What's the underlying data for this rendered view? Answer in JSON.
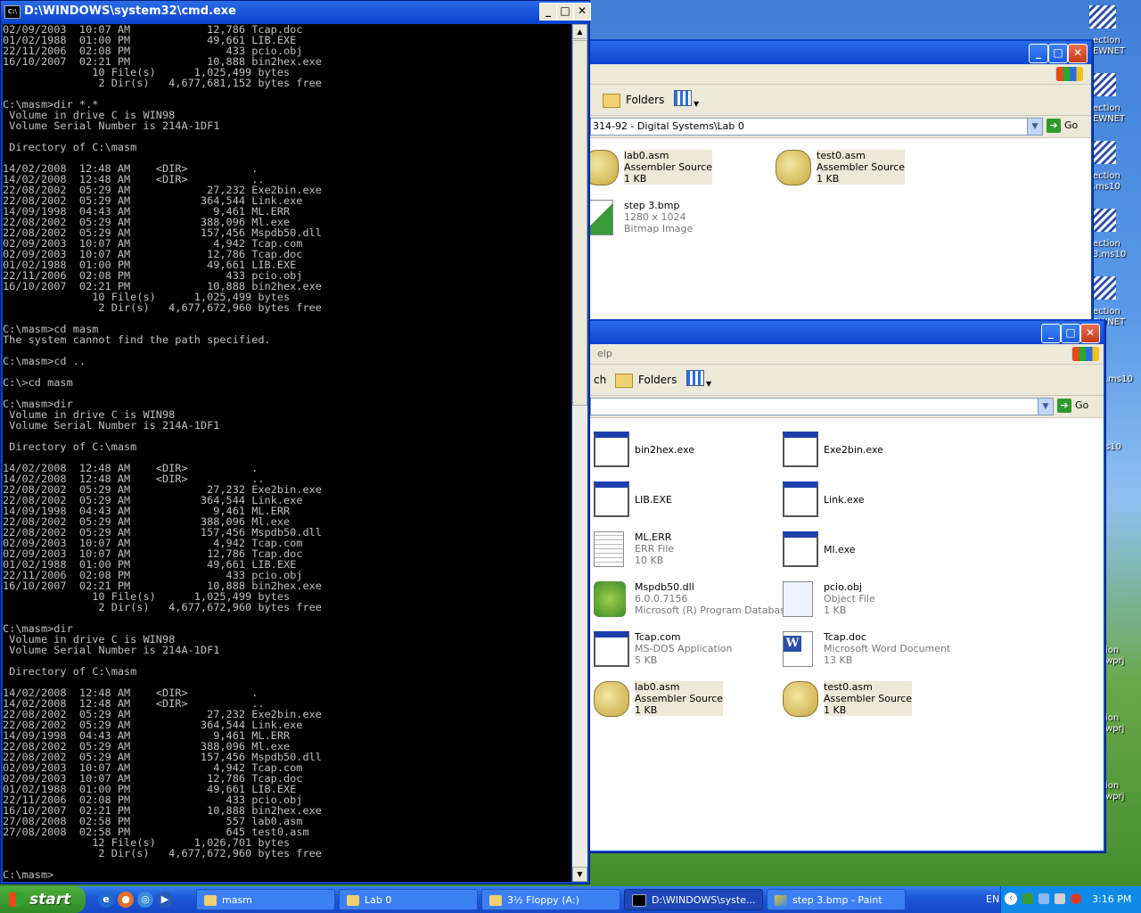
{
  "cmd": {
    "title": "D:\\WINDOWS\\system32\\cmd.exe",
    "icon_text": "C:\\",
    "lines": [
      "02/09/2003  10:07 AM            12,786 Tcap.doc",
      "01/02/1988  01:00 PM            49,661 LIB.EXE",
      "22/11/2006  02:08 PM               433 pcio.obj",
      "16/10/2007  02:21 PM            10,888 bin2hex.exe",
      "              10 File(s)      1,025,499 bytes",
      "               2 Dir(s)   4,677,681,152 bytes free",
      "",
      "C:\\masm>dir *.*",
      " Volume in drive C is WIN98",
      " Volume Serial Number is 214A-1DF1",
      "",
      " Directory of C:\\masm",
      "",
      "14/02/2008  12:48 AM    <DIR>          .",
      "14/02/2008  12:48 AM    <DIR>          ..",
      "22/08/2002  05:29 AM            27,232 Exe2bin.exe",
      "22/08/2002  05:29 AM           364,544 Link.exe",
      "14/09/1998  04:43 AM             9,461 ML.ERR",
      "22/08/2002  05:29 AM           388,096 Ml.exe",
      "22/08/2002  05:29 AM           157,456 Mspdb50.dll",
      "02/09/2003  10:07 AM             4,942 Tcap.com",
      "02/09/2003  10:07 AM            12,786 Tcap.doc",
      "01/02/1988  01:00 PM            49,661 LIB.EXE",
      "22/11/2006  02:08 PM               433 pcio.obj",
      "16/10/2007  02:21 PM            10,888 bin2hex.exe",
      "              10 File(s)      1,025,499 bytes",
      "               2 Dir(s)   4,677,672,960 bytes free",
      "",
      "C:\\masm>cd masm",
      "The system cannot find the path specified.",
      "",
      "C:\\masm>cd ..",
      "",
      "C:\\>cd masm",
      "",
      "C:\\masm>dir",
      " Volume in drive C is WIN98",
      " Volume Serial Number is 214A-1DF1",
      "",
      " Directory of C:\\masm",
      "",
      "14/02/2008  12:48 AM    <DIR>          .",
      "14/02/2008  12:48 AM    <DIR>          ..",
      "22/08/2002  05:29 AM            27,232 Exe2bin.exe",
      "22/08/2002  05:29 AM           364,544 Link.exe",
      "14/09/1998  04:43 AM             9,461 ML.ERR",
      "22/08/2002  05:29 AM           388,096 Ml.exe",
      "22/08/2002  05:29 AM           157,456 Mspdb50.dll",
      "02/09/2003  10:07 AM             4,942 Tcap.com",
      "02/09/2003  10:07 AM            12,786 Tcap.doc",
      "01/02/1988  01:00 PM            49,661 LIB.EXE",
      "22/11/2006  02:08 PM               433 pcio.obj",
      "16/10/2007  02:21 PM            10,888 bin2hex.exe",
      "              10 File(s)      1,025,499 bytes",
      "               2 Dir(s)   4,677,672,960 bytes free",
      "",
      "C:\\masm>dir",
      " Volume in drive C is WIN98",
      " Volume Serial Number is 214A-1DF1",
      "",
      " Directory of C:\\masm",
      "",
      "14/02/2008  12:48 AM    <DIR>          .",
      "14/02/2008  12:48 AM    <DIR>          ..",
      "22/08/2002  05:29 AM            27,232 Exe2bin.exe",
      "22/08/2002  05:29 AM           364,544 Link.exe",
      "14/09/1998  04:43 AM             9,461 ML.ERR",
      "22/08/2002  05:29 AM           388,096 Ml.exe",
      "22/08/2002  05:29 AM           157,456 Mspdb50.dll",
      "02/09/2003  10:07 AM             4,942 Tcap.com",
      "02/09/2003  10:07 AM            12,786 Tcap.doc",
      "01/02/1988  01:00 PM            49,661 LIB.EXE",
      "22/11/2006  02:08 PM               433 pcio.obj",
      "16/10/2007  02:21 PM            10,888 bin2hex.exe",
      "27/08/2008  02:58 PM               557 lab0.asm",
      "27/08/2008  02:58 PM               645 test0.asm",
      "              12 File(s)      1,026,701 bytes",
      "               2 Dir(s)   4,677,672,960 bytes free",
      "",
      "C:\\masm>"
    ]
  },
  "window_buttons": {
    "minimize": "_",
    "maximize": "□",
    "close": "✕"
  },
  "explorer1": {
    "folders_label": "Folders",
    "address": "314-92 - Digital Systems\\Lab 0",
    "go_label": "Go",
    "files": [
      {
        "name": "lab0.asm",
        "type": "Assembler Source",
        "size": "1 KB",
        "icon": "asm-file-icon"
      },
      {
        "name": "test0.asm",
        "type": "Assembler Source",
        "size": "1 KB",
        "icon": "asm-file-icon"
      },
      {
        "name": "step 3.bmp",
        "type": "1280 x 1024",
        "size": "Bitmap Image",
        "icon": "bitmap-file-icon"
      }
    ]
  },
  "explorer2": {
    "menu_fragment": "elp",
    "toolbar_fragment": "ch",
    "folders_label": "Folders",
    "address": "",
    "go_label": "Go",
    "files": [
      {
        "name": "bin2hex.exe",
        "type": "",
        "size": "",
        "icon": "exe-file-icon"
      },
      {
        "name": "Exe2bin.exe",
        "type": "",
        "size": "",
        "icon": "exe-file-icon"
      },
      {
        "name": "LIB.EXE",
        "type": "",
        "size": "",
        "icon": "exe-file-icon"
      },
      {
        "name": "Link.exe",
        "type": "",
        "size": "",
        "icon": "exe-file-icon"
      },
      {
        "name": "ML.ERR",
        "type": "ERR File",
        "size": "10 KB",
        "icon": "err-file-icon"
      },
      {
        "name": "Ml.exe",
        "type": "",
        "size": "",
        "icon": "exe-file-icon"
      },
      {
        "name": "Mspdb50.dll",
        "type": "6.0.0.7156",
        "size": "Microsoft (R) Program Database",
        "icon": "dll-file-icon"
      },
      {
        "name": "pcio.obj",
        "type": "Object File",
        "size": "1 KB",
        "icon": "obj-file-icon"
      },
      {
        "name": "Tcap.com",
        "type": "MS-DOS Application",
        "size": "5 KB",
        "icon": "exe-file-icon"
      },
      {
        "name": "Tcap.doc",
        "type": "Microsoft Word Document",
        "size": "13 KB",
        "icon": "word-doc-icon"
      },
      {
        "name": "lab0.asm",
        "type": "Assembler Source",
        "size": "1 KB",
        "icon": "asm-file-icon"
      },
      {
        "name": "test0.asm",
        "type": "Assembler Source",
        "size": "1 KB",
        "icon": "asm-file-icon"
      }
    ]
  },
  "desktop_labels": [
    "ection",
    "EWNET",
    "ection",
    "EWNET",
    "ection",
    ".ms10",
    "ection",
    "3.ms10",
    "ection",
    "EWNET",
    ".ms10",
    "s10",
    "ion",
    "wprj",
    "ion",
    "wprj",
    "ion",
    "wprj"
  ],
  "taskbar": {
    "start_label": "start",
    "tasks": [
      {
        "label": "masm",
        "icon": "folder-icon"
      },
      {
        "label": "Lab 0",
        "icon": "folder-icon"
      },
      {
        "label": "3½ Floppy (A:)",
        "icon": "folder-icon"
      },
      {
        "label": "D:\\WINDOWS\\syste...",
        "icon": "cmd-icon"
      },
      {
        "label": "step 3.bmp - Paint",
        "icon": "paint-icon"
      }
    ],
    "tray": {
      "language": "EN",
      "clock": "3:16 PM"
    }
  },
  "colors": {
    "xp_blue": "#0a43c8",
    "console_bg": "#000000",
    "console_fg": "#c0c0c0",
    "start_green": "#3a9a2e"
  }
}
